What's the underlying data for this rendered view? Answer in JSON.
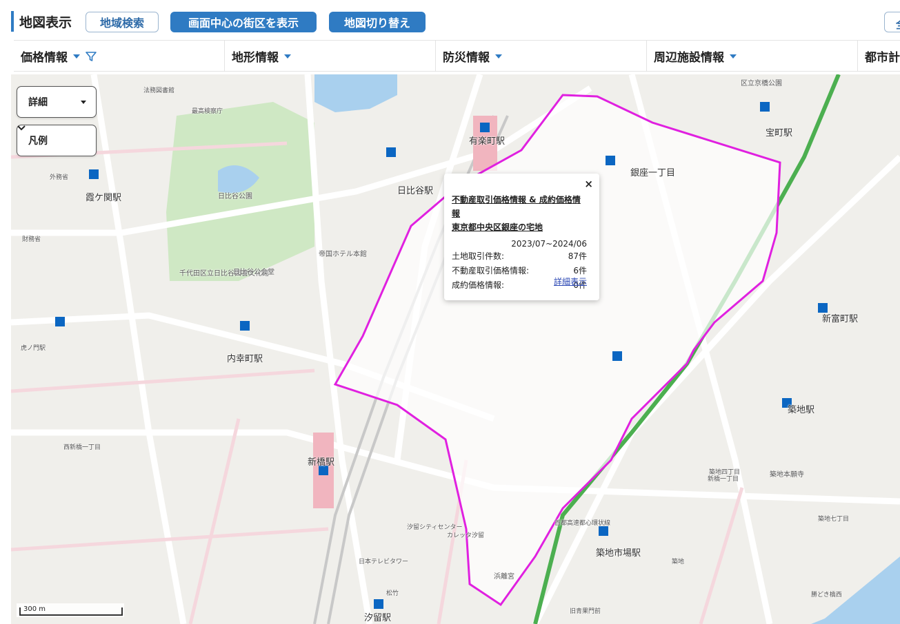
{
  "header": {
    "title": "地図表示",
    "buttons": {
      "region_search": "地域検索",
      "show_center_block": "画面中心の街区を表示",
      "switch_map": "地図切り替え",
      "overflow": "全"
    }
  },
  "tabs": [
    {
      "label": "価格情報",
      "has_filter": true
    },
    {
      "label": "地形情報"
    },
    {
      "label": "防災情報"
    },
    {
      "label": "周辺施設情報"
    },
    {
      "label": "都市計"
    }
  ],
  "map": {
    "controls": {
      "detail": "詳細",
      "legend": "凡例"
    },
    "scale_label": "300 m",
    "highlight_color": "#e020e0",
    "station_marker_color": "#0b66c2",
    "labels": {
      "stations": [
        "有楽町駅",
        "新橋駅",
        "汐留駅",
        "日比谷駅",
        "内幸町駅",
        "霞ケ関駅",
        "宝町駅",
        "築地駅",
        "新富町駅",
        "築地市場駅",
        "銀座一丁目"
      ],
      "stations_short": [
        "有楽町",
        "日比谷",
        "汐留",
        "新橋"
      ],
      "areas": [
        "日比谷公園",
        "帝国ホテル本館",
        "千代田区立日比谷図書文化館",
        "日比谷公会堂",
        "築地本願寺",
        "浜離宮",
        "区立京橋公園"
      ],
      "small": [
        "法務図書館",
        "最高検察庁",
        "財務省",
        "外務省",
        "汐留シティセンター",
        "カレッタ汐留",
        "日本テレビタワー",
        "松竹",
        "築地",
        "新橋一丁目",
        "築地四丁目",
        "築地七丁目",
        "勝どき橋西",
        "旧青果門前",
        "首都高速都心環状線",
        "西新橋一丁目",
        "虎ノ門駅"
      ]
    }
  },
  "popup": {
    "close": "×",
    "title_line1": "不動産取引価格情報 & 成約価格情報",
    "title_line2": "東京都中央区銀座の宅地",
    "period": "2023/07~2024/06",
    "rows": [
      {
        "label": "土地取引件数:",
        "value": "87件"
      },
      {
        "label": "不動産取引価格情報:",
        "value": "6件"
      },
      {
        "label": "成約価格情報:",
        "value": "0件"
      }
    ],
    "link": "詳細表示"
  }
}
